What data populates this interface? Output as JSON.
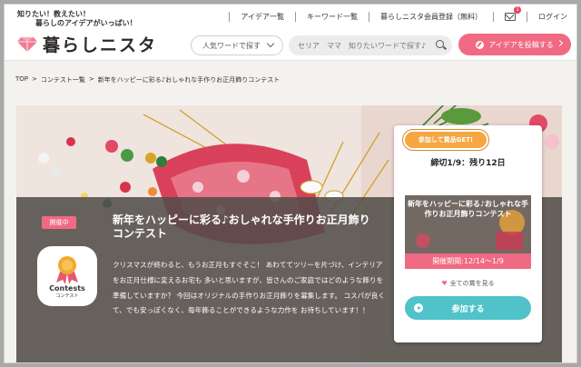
{
  "header": {
    "tagline_line1": "知りたい！教えたい！",
    "tagline_line2": "暮らしのアイデアがいっぱい！",
    "logo_text": "暮らしニスタ",
    "nav": {
      "ideas": "アイデア一覧",
      "keywords": "キーワード一覧",
      "register": "暮らしニスタ会員登録（無料）",
      "mail_count": "1",
      "login": "ログイン"
    },
    "popular_select": "人気ワードで探す",
    "search_placeholder": "セリア　ママ　知りたいワードで探す♪",
    "post_button": "アイデアを投稿する"
  },
  "breadcrumb": {
    "top": "TOP",
    "sep": ">",
    "contests": "コンテスト一覧",
    "current": "新年をハッピーに彩る♪おしゃれな手作りお正月飾りコンテスト"
  },
  "hero": {
    "status": "開催中",
    "title": "新年をハッピーに彩る♪おしゃれな手作りお正月飾りコンテスト",
    "contest_icon_en": "Contests",
    "contest_icon_jp": "コンテスト",
    "description": "クリスマスが終わると、もうお正月もすぐそこ！ あわててツリーを片づけ、インテリアをお正月仕様に変えるお宅も 多いと思いますが、皆さんのご家庭ではどのような飾りを準備していますか？ 今回はオリジナルの手作りお正月飾りを募集します。 コスパが良くて、でも安っぽくなく、毎年飾ることができるような力作を お待ちしています！！"
  },
  "card": {
    "prize_tag": "参加して賞品GET!",
    "deadline": "締切1/9：残り12日",
    "thumb_text": "新年をハッピーに彩る♪おしゃれな手作りお正月飾りコンテスト",
    "period": "開催期間:12/14〜1/9",
    "see_all": "全ての賞を見る",
    "join_button": "参加する"
  },
  "colors": {
    "accent_pink": "#f06a83",
    "join_teal": "#4fc3c9",
    "prize_orange": "#f6a742"
  }
}
